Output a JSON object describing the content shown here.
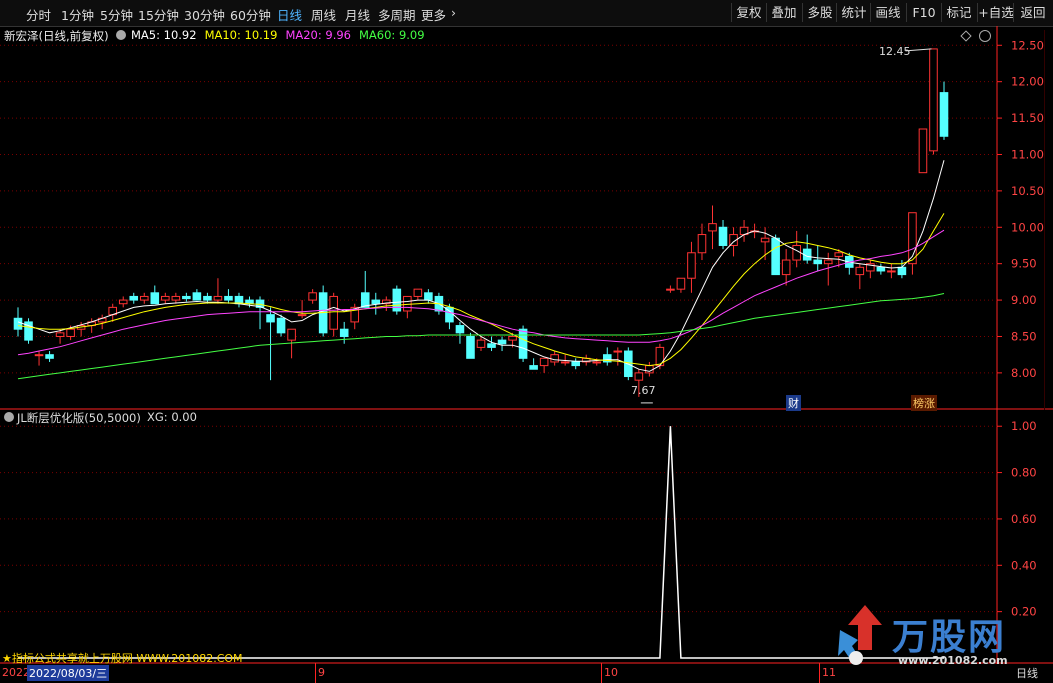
{
  "toolbar": {
    "periods": [
      "分时",
      "1分钟",
      "5分钟",
      "15分钟",
      "30分钟",
      "60分钟",
      "日线",
      "周线",
      "月线",
      "多周期",
      "更多"
    ],
    "active_period": "日线",
    "buttons": [
      "复权",
      "叠加",
      "多股",
      "统计",
      "画线",
      "F10",
      "标记",
      "+自选",
      "返回"
    ]
  },
  "stock": {
    "title": "新宏泽(日线,前复权)",
    "ma": [
      {
        "label": "MA5: 10.92",
        "color": "#ffffff"
      },
      {
        "label": "MA10: 10.19",
        "color": "#ffff00"
      },
      {
        "label": "MA20: 9.96",
        "color": "#ff44ff"
      },
      {
        "label": "MA60: 9.09",
        "color": "#44ff44"
      }
    ]
  },
  "indicator": {
    "title": "JL断层优化版(50,5000)",
    "value_label": "XG: 0.00"
  },
  "colors": {
    "up": "#ff3333",
    "down": "#55ffff",
    "axis": "#ff2222",
    "grid": "#7a0000"
  },
  "icons": [
    "diamond-icon",
    "settings-icon",
    "indicator-toggle-icon",
    "star-icon"
  ],
  "annotations": {
    "high": "12.45",
    "low": "7.67",
    "tag_finance": "财",
    "tag_rank": "榜涨"
  },
  "footer": {
    "promo": "★指标公式共享就上万股网 WWW.201082.COM",
    "date_prefix": "2022",
    "date": "2022/08/03/三",
    "months": [
      "9",
      "10",
      "11"
    ]
  },
  "right_strip": {
    "bottom": "日线"
  },
  "watermark": {
    "brand": "万股网",
    "url": "www.201082.com"
  },
  "chart_data": [
    {
      "type": "candlestick",
      "title": "新宏泽(日线,前复权)",
      "ylim": [
        7.6,
        12.6
      ],
      "yticks": [
        8.0,
        8.5,
        9.0,
        9.5,
        10.0,
        10.5,
        11.0,
        11.5,
        12.0,
        12.5
      ],
      "candles": [
        [
          8.75,
          8.9,
          8.5,
          8.6
        ],
        [
          8.7,
          8.75,
          8.4,
          8.45
        ],
        [
          8.25,
          8.3,
          8.1,
          8.25
        ],
        [
          8.25,
          8.3,
          8.15,
          8.2
        ],
        [
          8.5,
          8.6,
          8.4,
          8.55
        ],
        [
          8.5,
          8.65,
          8.45,
          8.6
        ],
        [
          8.6,
          8.7,
          8.5,
          8.65
        ],
        [
          8.65,
          8.75,
          8.55,
          8.7
        ],
        [
          8.7,
          8.8,
          8.6,
          8.75
        ],
        [
          8.8,
          8.95,
          8.7,
          8.9
        ],
        [
          8.95,
          9.05,
          8.9,
          9.0
        ],
        [
          9.05,
          9.1,
          8.95,
          9.0
        ],
        [
          9.0,
          9.1,
          8.95,
          9.05
        ],
        [
          9.1,
          9.2,
          9.0,
          8.95
        ],
        [
          9.0,
          9.1,
          8.95,
          9.05
        ],
        [
          9.0,
          9.1,
          8.95,
          9.05
        ],
        [
          9.05,
          9.1,
          8.98,
          9.02
        ],
        [
          9.1,
          9.15,
          9.0,
          9.0
        ],
        [
          9.05,
          9.1,
          8.95,
          9.0
        ],
        [
          9.0,
          9.3,
          8.95,
          9.05
        ],
        [
          9.05,
          9.15,
          8.95,
          9.0
        ],
        [
          9.05,
          9.1,
          8.9,
          8.95
        ],
        [
          9.0,
          9.05,
          8.9,
          8.95
        ],
        [
          9.0,
          9.05,
          8.6,
          8.9
        ],
        [
          8.8,
          8.9,
          7.9,
          8.7
        ],
        [
          8.75,
          8.8,
          8.5,
          8.55
        ],
        [
          8.45,
          8.6,
          8.2,
          8.6
        ],
        [
          8.8,
          9.0,
          8.75,
          8.8
        ],
        [
          9.0,
          9.15,
          8.95,
          9.1
        ],
        [
          9.1,
          9.2,
          8.5,
          8.55
        ],
        [
          8.6,
          9.1,
          8.5,
          9.05
        ],
        [
          8.6,
          8.7,
          8.4,
          8.5
        ],
        [
          8.7,
          8.95,
          8.6,
          8.9
        ],
        [
          9.1,
          9.4,
          9.0,
          8.9
        ],
        [
          9.0,
          9.1,
          8.8,
          8.95
        ],
        [
          8.95,
          9.05,
          8.85,
          9.0
        ],
        [
          9.15,
          9.2,
          8.8,
          8.85
        ],
        [
          8.85,
          9.05,
          8.75,
          9.05
        ],
        [
          9.05,
          9.1,
          9.0,
          9.15
        ],
        [
          9.1,
          9.15,
          8.95,
          9.0
        ],
        [
          9.05,
          9.1,
          8.8,
          8.85
        ],
        [
          8.9,
          8.95,
          8.6,
          8.7
        ],
        [
          8.65,
          8.7,
          8.4,
          8.55
        ],
        [
          8.5,
          8.55,
          8.2,
          8.2
        ],
        [
          8.35,
          8.5,
          8.3,
          8.45
        ],
        [
          8.4,
          8.5,
          8.3,
          8.35
        ],
        [
          8.45,
          8.5,
          8.3,
          8.4
        ],
        [
          8.45,
          8.55,
          8.35,
          8.5
        ],
        [
          8.6,
          8.65,
          8.15,
          8.2
        ],
        [
          8.1,
          8.2,
          8.05,
          8.05
        ],
        [
          8.1,
          8.2,
          8.0,
          8.2
        ],
        [
          8.15,
          8.3,
          8.1,
          8.25
        ],
        [
          8.15,
          8.25,
          8.1,
          8.15
        ],
        [
          8.15,
          8.2,
          8.05,
          8.1
        ],
        [
          8.15,
          8.25,
          8.1,
          8.2
        ],
        [
          8.15,
          8.2,
          8.1,
          8.15
        ],
        [
          8.25,
          8.35,
          8.1,
          8.15
        ],
        [
          8.3,
          8.35,
          8.1,
          8.3
        ],
        [
          8.3,
          8.35,
          7.9,
          7.95
        ],
        [
          7.9,
          8.05,
          7.67,
          8.0
        ],
        [
          8.0,
          8.15,
          7.95,
          8.1
        ],
        [
          8.1,
          8.4,
          8.05,
          8.35
        ],
        [
          9.15,
          9.2,
          9.1,
          9.15
        ],
        [
          9.15,
          9.3,
          9.1,
          9.3
        ],
        [
          9.3,
          9.8,
          9.1,
          9.65
        ],
        [
          9.65,
          10.05,
          9.55,
          9.9
        ],
        [
          9.95,
          10.3,
          9.7,
          10.05
        ],
        [
          10.0,
          10.1,
          9.7,
          9.75
        ],
        [
          9.75,
          10.0,
          9.6,
          9.9
        ],
        [
          9.9,
          10.1,
          9.8,
          10.0
        ],
        [
          9.95,
          10.05,
          9.85,
          9.95
        ],
        [
          9.8,
          10.0,
          9.55,
          9.85
        ],
        [
          9.85,
          9.9,
          9.35,
          9.35
        ],
        [
          9.35,
          9.7,
          9.2,
          9.55
        ],
        [
          9.55,
          9.95,
          9.45,
          9.75
        ],
        [
          9.7,
          9.9,
          9.5,
          9.55
        ],
        [
          9.55,
          9.75,
          9.4,
          9.5
        ],
        [
          9.5,
          9.65,
          9.2,
          9.55
        ],
        [
          9.6,
          9.7,
          9.45,
          9.65
        ],
        [
          9.6,
          9.65,
          9.35,
          9.45
        ],
        [
          9.35,
          9.5,
          9.15,
          9.45
        ],
        [
          9.4,
          9.55,
          9.3,
          9.5
        ],
        [
          9.45,
          9.5,
          9.35,
          9.4
        ],
        [
          9.4,
          9.5,
          9.3,
          9.4
        ],
        [
          9.45,
          9.55,
          9.3,
          9.35
        ],
        [
          9.5,
          10.2,
          9.35,
          10.2
        ],
        [
          10.75,
          11.35,
          10.75,
          11.35
        ],
        [
          11.05,
          12.45,
          11.0,
          12.45
        ],
        [
          11.85,
          12.0,
          11.2,
          11.25
        ]
      ],
      "series": [
        {
          "name": "MA5",
          "color": "#ffffff",
          "values": [
            8.7,
            8.65,
            8.6,
            8.55,
            8.58,
            8.62,
            8.66,
            8.7,
            8.75,
            8.8,
            8.85,
            8.9,
            8.92,
            8.93,
            8.95,
            8.96,
            8.97,
            8.98,
            8.97,
            8.97,
            8.96,
            8.95,
            8.93,
            8.91,
            8.85,
            8.78,
            8.7,
            8.72,
            8.8,
            8.85,
            8.9,
            8.85,
            8.88,
            8.92,
            8.94,
            8.96,
            8.97,
            8.98,
            9.0,
            9.0,
            8.95,
            8.85,
            8.72,
            8.6,
            8.5,
            8.42,
            8.38,
            8.38,
            8.34,
            8.28,
            8.22,
            8.18,
            8.17,
            8.16,
            8.16,
            8.17,
            8.18,
            8.18,
            8.12,
            8.05,
            8.02,
            8.1,
            8.3,
            8.55,
            8.85,
            9.15,
            9.45,
            9.65,
            9.8,
            9.9,
            9.95,
            9.92,
            9.85,
            9.75,
            9.68,
            9.6,
            9.58,
            9.57,
            9.56,
            9.52,
            9.5,
            9.48,
            9.46,
            9.44,
            9.45,
            9.6,
            9.95,
            10.4,
            10.92
          ]
        },
        {
          "name": "MA10",
          "color": "#ffff00",
          "values": [
            8.65,
            8.63,
            8.61,
            8.6,
            8.6,
            8.61,
            8.63,
            8.65,
            8.68,
            8.72,
            8.76,
            8.8,
            8.84,
            8.87,
            8.9,
            8.92,
            8.94,
            8.95,
            8.96,
            8.96,
            8.96,
            8.96,
            8.95,
            8.94,
            8.91,
            8.87,
            8.84,
            8.82,
            8.82,
            8.83,
            8.84,
            8.84,
            8.86,
            8.88,
            8.9,
            8.92,
            8.93,
            8.94,
            8.95,
            8.96,
            8.95,
            8.91,
            8.86,
            8.79,
            8.73,
            8.67,
            8.6,
            8.53,
            8.46,
            8.4,
            8.35,
            8.3,
            8.26,
            8.22,
            8.2,
            8.18,
            8.17,
            8.16,
            8.14,
            8.12,
            8.1,
            8.12,
            8.2,
            8.32,
            8.48,
            8.65,
            8.83,
            9.01,
            9.19,
            9.36,
            9.5,
            9.62,
            9.72,
            9.78,
            9.8,
            9.78,
            9.75,
            9.72,
            9.68,
            9.62,
            9.58,
            9.55,
            9.52,
            9.5,
            9.5,
            9.55,
            9.7,
            9.95,
            10.19
          ]
        },
        {
          "name": "MA20",
          "color": "#ff44ff",
          "values": [
            8.25,
            8.27,
            8.3,
            8.33,
            8.36,
            8.4,
            8.44,
            8.48,
            8.52,
            8.56,
            8.6,
            8.63,
            8.66,
            8.69,
            8.72,
            8.74,
            8.76,
            8.78,
            8.8,
            8.81,
            8.82,
            8.83,
            8.84,
            8.84,
            8.84,
            8.84,
            8.84,
            8.84,
            8.85,
            8.86,
            8.86,
            8.87,
            8.87,
            8.88,
            8.89,
            8.9,
            8.9,
            8.9,
            8.89,
            8.88,
            8.86,
            8.83,
            8.8,
            8.76,
            8.72,
            8.68,
            8.64,
            8.6,
            8.57,
            8.55,
            8.52,
            8.5,
            8.48,
            8.47,
            8.46,
            8.45,
            8.44,
            8.43,
            8.42,
            8.42,
            8.42,
            8.44,
            8.47,
            8.52,
            8.58,
            8.65,
            8.73,
            8.82,
            8.9,
            8.98,
            9.06,
            9.12,
            9.18,
            9.24,
            9.3,
            9.35,
            9.4,
            9.44,
            9.48,
            9.52,
            9.55,
            9.57,
            9.6,
            9.62,
            9.65,
            9.7,
            9.78,
            9.87,
            9.96
          ]
        },
        {
          "name": "MA60",
          "color": "#44ff44",
          "values": [
            7.92,
            7.94,
            7.96,
            7.98,
            8.0,
            8.02,
            8.04,
            8.06,
            8.08,
            8.1,
            8.12,
            8.14,
            8.16,
            8.18,
            8.2,
            8.22,
            8.24,
            8.26,
            8.28,
            8.3,
            8.32,
            8.34,
            8.36,
            8.38,
            8.39,
            8.4,
            8.41,
            8.42,
            8.43,
            8.44,
            8.45,
            8.46,
            8.47,
            8.48,
            8.49,
            8.5,
            8.5,
            8.51,
            8.51,
            8.52,
            8.52,
            8.52,
            8.52,
            8.52,
            8.52,
            8.52,
            8.52,
            8.52,
            8.52,
            8.52,
            8.52,
            8.52,
            8.52,
            8.52,
            8.52,
            8.52,
            8.52,
            8.52,
            8.52,
            8.52,
            8.53,
            8.54,
            8.55,
            8.57,
            8.59,
            8.61,
            8.63,
            8.66,
            8.69,
            8.72,
            8.75,
            8.77,
            8.79,
            8.81,
            8.83,
            8.85,
            8.87,
            8.89,
            8.91,
            8.93,
            8.95,
            8.97,
            8.99,
            9.0,
            9.01,
            9.02,
            9.04,
            9.06,
            9.09
          ]
        }
      ]
    },
    {
      "type": "line",
      "title": "JL断层优化版(50,5000)",
      "ylim": [
        0,
        1.07
      ],
      "yticks": [
        0.2,
        0.4,
        0.6,
        0.8,
        1.0
      ],
      "series": [
        {
          "name": "XG",
          "color": "#ffffff",
          "values": [
            0,
            0,
            0,
            0,
            0,
            0,
            0,
            0,
            0,
            0,
            0,
            0,
            0,
            0,
            0,
            0,
            0,
            0,
            0,
            0,
            0,
            0,
            0,
            0,
            0,
            0,
            0,
            0,
            0,
            0,
            0,
            0,
            0,
            0,
            0,
            0,
            0,
            0,
            0,
            0,
            0,
            0,
            0,
            0,
            0,
            0,
            0,
            0,
            0,
            0,
            0,
            0,
            0,
            0,
            0,
            0,
            0,
            0,
            0,
            0,
            0,
            0,
            1,
            0,
            0,
            0,
            0,
            0,
            0,
            0,
            0,
            0,
            0,
            0,
            0,
            0,
            0,
            0,
            0,
            0,
            0,
            0,
            0,
            0,
            0,
            0,
            0,
            0,
            0
          ]
        }
      ]
    }
  ]
}
